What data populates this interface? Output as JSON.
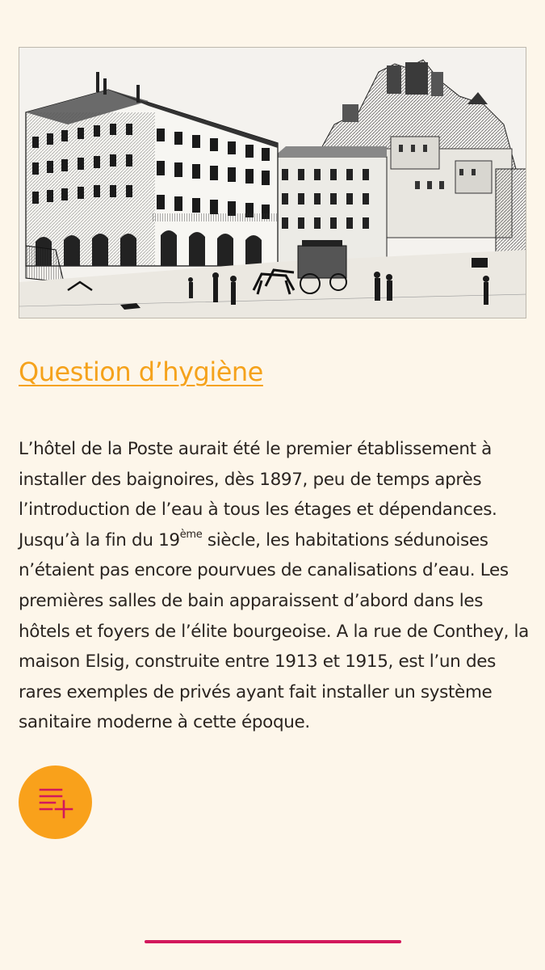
{
  "article": {
    "image_alt": "",
    "title": "Question d’hygiène",
    "paragraph_before_sup": "L’hôtel de la Poste aurait été le premier établissement à installer des baignoires, dès 1897, peu de temps après l’introduction de l’eau à tous les étages et dépendances. Jusqu’à la fin du 19",
    "paragraph_sup": "ème",
    "paragraph_after_sup": " siècle, les habitations sédunoises n’étaient pas encore pourvues de canalisations d’eau. Les premières salles de bain apparaissent d’abord dans les hôtels et foyers de l’élite bourgeoise. A la rue de Conthey, la maison Elsig, construite entre 1913 et 1915, est l’un des rares exemples de privés ayant fait installer un système sanitaire moderne à cette époque."
  },
  "fab": {
    "icon": "playlist-add-icon"
  },
  "colors": {
    "background": "#fdf6ea",
    "title": "#f5a21b",
    "fab": "#f9a11b",
    "fab_icon": "#d2185c",
    "home_indicator": "#d2185c",
    "text": "#2a2420"
  }
}
